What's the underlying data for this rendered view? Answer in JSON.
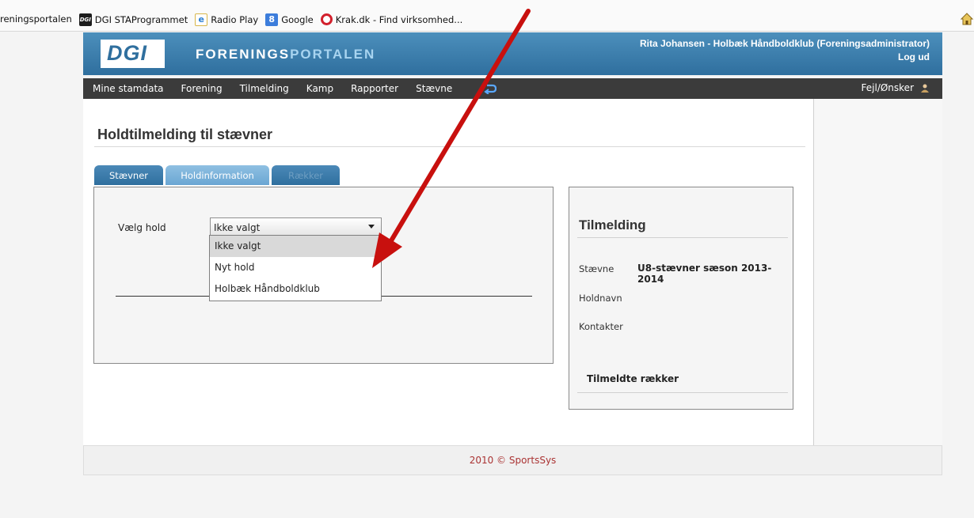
{
  "bookmarks": [
    {
      "label": "reningsportalen",
      "icon": "none"
    },
    {
      "label": "DGI STAProgrammet",
      "icon": "dgi-icon",
      "icon_text": "DGI"
    },
    {
      "label": "Radio Play",
      "icon": "ie-page-icon",
      "icon_text": "e"
    },
    {
      "label": "Google",
      "icon": "google-icon",
      "icon_text": "8"
    },
    {
      "label": "Krak.dk - Find virksomhed...",
      "icon": "krak-icon",
      "icon_text": ""
    }
  ],
  "header": {
    "logo_text": "DGI",
    "portal_strong": "FORENINGS",
    "portal_light": "PORTALEN",
    "user": "Rita Johansen - Holbæk Håndboldklub (Foreningsadministrator)",
    "logout": "Log ud"
  },
  "nav": {
    "items": [
      "Mine stamdata",
      "Forening",
      "Tilmelding",
      "Kamp",
      "Rapporter",
      "Stævne"
    ],
    "right_label": "Fejl/Ønsker"
  },
  "page": {
    "title": "Holdtilmelding til stævner"
  },
  "tabs": [
    "Stævner",
    "Holdinformation",
    "Rækker"
  ],
  "form": {
    "label": "Vælg hold",
    "selected": "Ikke valgt",
    "options": [
      "Ikke valgt",
      "Nyt hold",
      "Holbæk Håndboldklub"
    ]
  },
  "tilmelding": {
    "title": "Tilmelding",
    "rows": [
      {
        "label": "Stævne",
        "value": "U8-stævner sæson 2013-2014"
      },
      {
        "label": "Holdnavn",
        "value": ""
      },
      {
        "label": "Kontakter",
        "value": ""
      }
    ],
    "subheading": "Tilmeldte rækker"
  },
  "footer": {
    "text": "2010 © SportsSys"
  },
  "colors": {
    "header_blue": "#2f6f9e",
    "nav_dark": "#3b3b3b",
    "annotation_red": "#c8100e"
  }
}
